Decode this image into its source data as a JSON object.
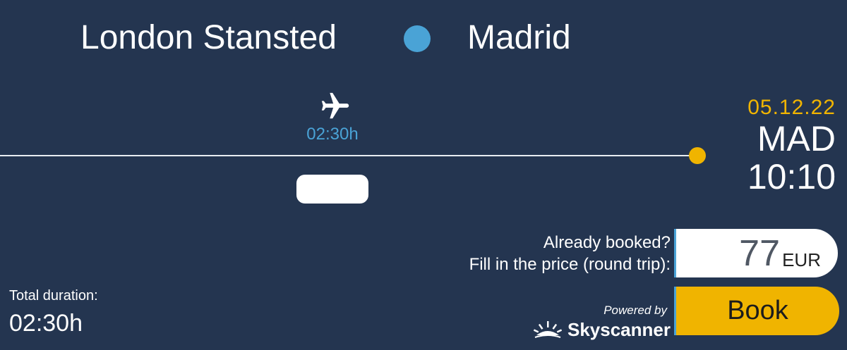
{
  "route": {
    "origin": "London Stansted",
    "destination": "Madrid"
  },
  "segment": {
    "icon": "airplane-icon",
    "duration": "02:30h"
  },
  "arrival": {
    "date": "05.12.22",
    "airport_code": "MAD",
    "time": "10:10"
  },
  "booking": {
    "label_line1": "Already booked?",
    "label_line2": "Fill in the price (round trip):",
    "price_value": "77",
    "currency": "EUR",
    "book_label": "Book"
  },
  "branding": {
    "powered_by": "Powered by",
    "provider": "Skyscanner"
  },
  "summary": {
    "total_label": "Total duration:",
    "total_value": "02:30h"
  },
  "colors": {
    "background": "#243550",
    "accent_blue": "#4aa3d6",
    "accent_yellow": "#f0b400",
    "text": "#ffffff"
  }
}
